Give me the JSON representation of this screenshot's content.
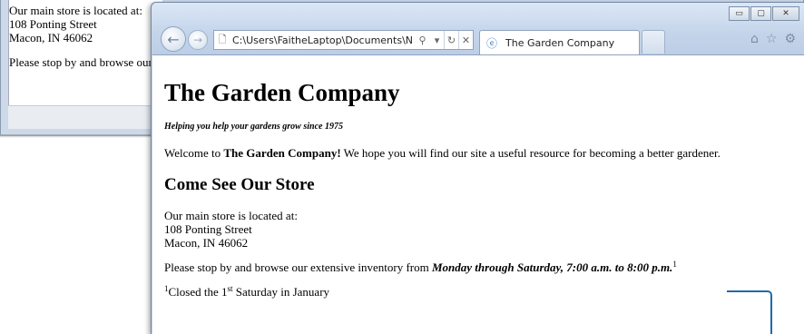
{
  "background_window": {
    "lines": [
      "Our main store is located at:",
      "108 Ponting Street",
      "Macon, IN 46062",
      "Please stop by and browse our extensive inventory"
    ]
  },
  "browser": {
    "window_controls": {
      "minimize": "▭",
      "maximize": "▢",
      "close": "✕"
    },
    "address": {
      "url": "C:\\Users\\FaitheLaptop\\Documents\\N",
      "search_glyph": "⚲",
      "dropdown_glyph": "▾",
      "refresh_glyph": "↻",
      "stop_glyph": "✕"
    },
    "tab": {
      "title": "The Garden Company",
      "icon": "ie-icon"
    },
    "toolbar": {
      "home": "⌂",
      "favorites": "☆",
      "settings": "⚙"
    }
  },
  "page": {
    "heading": "The Garden Company",
    "tagline": "Helping you help your gardens grow since 1975",
    "welcome": {
      "prefix": "Welcome to ",
      "company": "The Garden Company!",
      "suffix": " We hope you will find our site a useful resource for becoming a better gardener."
    },
    "store_heading": "Come See Our Store",
    "address_lines": [
      "Our main store is located at:",
      "108 Ponting Street",
      "Macon, IN 46062"
    ],
    "visit": {
      "prefix": "Please stop by and browse our extensive inventory from ",
      "hours": "Monday through Saturday, 7:00 a.m. to 8:00 p.m.",
      "footnote_mark": "1"
    },
    "footnote": {
      "mark": "1",
      "prefix": "Closed the 1",
      "ordinal": "st",
      "suffix": " Saturday in January"
    }
  },
  "colors": {
    "callout": "#1f6aa8",
    "window_frame": "#c6d6ea"
  }
}
